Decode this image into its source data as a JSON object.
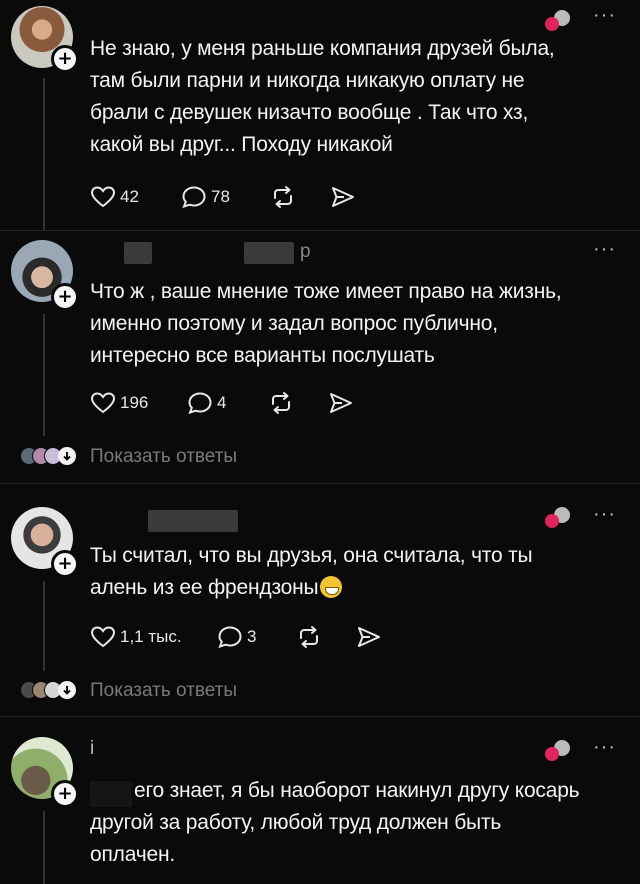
{
  "comments": [
    {
      "username": "",
      "text_lines": [
        "Не знаю, у меня раньше компания друзей была,",
        "там были парни и никогда никакую оплату не",
        "брали с девушек низачто вообще . Так что хз,",
        "какой вы друг... Походу никакой"
      ],
      "likes": "42",
      "replies": "78",
      "show_replies": ""
    },
    {
      "username": "р",
      "text_lines": [
        "Что ж , ваше мнение тоже имеет право на жизнь,",
        "именно поэтому и задал вопрос публично,",
        "интересно все варианты послушать"
      ],
      "likes": "196",
      "replies": "4",
      "show_replies": "Показать ответы"
    },
    {
      "username": "",
      "text_lines": [
        "Ты считал, что вы друзья, она считала, что ты",
        "алень из ее френдзоны"
      ],
      "likes": "1,1 тыс.",
      "replies": "3",
      "show_replies": "Показать ответы"
    },
    {
      "username": "i",
      "text_lines": [
        "его знает, я бы наоборот накинул другу косарь",
        "другой за работу, любой труд должен быть",
        "оплачен."
      ],
      "likes": "",
      "replies": "",
      "show_replies": ""
    }
  ],
  "icons": {
    "like": "heart-outline-icon",
    "reply": "speech-bubble-icon",
    "repost": "repost-arrows-icon",
    "share": "send-icon",
    "more": "more-dots-icon",
    "follow": "plus-icon",
    "author_reaction": "heart-reaction-icon",
    "emoji": "grinning-emoji-icon"
  },
  "colors": {
    "background": "#0a0a0a",
    "text": "#f3f3f3",
    "muted": "#7a7a7a",
    "reaction_red": "#e0245e"
  },
  "ui": {
    "more_glyph": "···",
    "plus_glyph": "+"
  }
}
